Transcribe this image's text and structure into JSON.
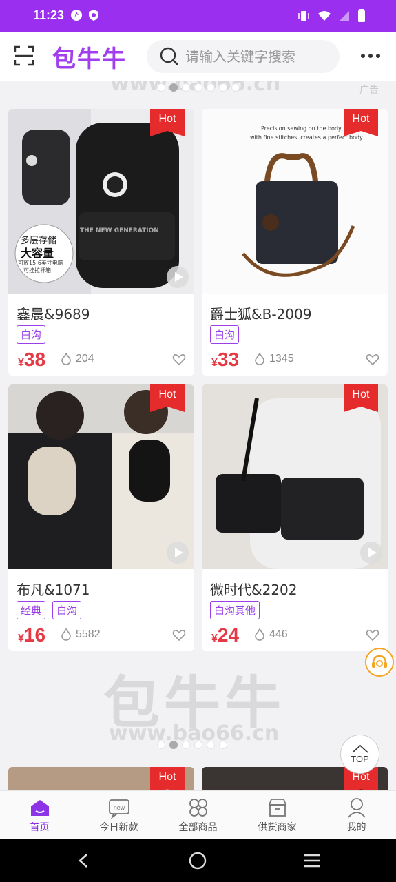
{
  "status_bar": {
    "time": "11:23"
  },
  "header": {
    "logo": "包牛牛",
    "search_placeholder": "请输入关键字搜索"
  },
  "banner": {
    "watermark_logo": "包牛牛",
    "watermark_url": "www.bao66.cn",
    "ad_label": "广告"
  },
  "products": [
    {
      "title": "鑫晨&9689",
      "tags": [
        "白沟"
      ],
      "price_symbol": "¥",
      "price": "38",
      "heat": "204",
      "badge": "Hot",
      "image_caption": "多层存储",
      "image_caption2": "大容量",
      "image_caption3": "可放15.6英寸电脑",
      "image_caption4": "可挂拉杆箱",
      "bag_print": "THE NEW GENERATION"
    },
    {
      "title": "爵士狐&B-2009",
      "tags": [
        "白沟"
      ],
      "price_symbol": "¥",
      "price": "33",
      "heat": "1345",
      "badge": "Hot",
      "image_caption": "Precision sewing on the body,",
      "image_caption2": "with fine stitches, creates a perfect body."
    },
    {
      "title": "布凡&1071",
      "tags": [
        "经典",
        "白沟"
      ],
      "price_symbol": "¥",
      "price": "16",
      "heat": "5582",
      "badge": "Hot"
    },
    {
      "title": "微时代&2202",
      "tags": [
        "白沟其他"
      ],
      "price_symbol": "¥",
      "price": "24",
      "heat": "446",
      "badge": "Hot"
    }
  ],
  "partial_badges": [
    "Hot",
    "Hot"
  ],
  "top_button": "TOP",
  "tabbar": [
    {
      "label": "首页",
      "icon": "home-icon",
      "active": true
    },
    {
      "label": "今日新款",
      "icon": "new-icon",
      "active": false
    },
    {
      "label": "全部商品",
      "icon": "grid-icon",
      "active": false
    },
    {
      "label": "供货商家",
      "icon": "store-icon",
      "active": false
    },
    {
      "label": "我的",
      "icon": "user-icon",
      "active": false
    }
  ],
  "colors": {
    "brand": "#9b2ff0",
    "price": "#e53a45",
    "hot": "#e52b2b",
    "tag": "#9b3fe8"
  }
}
